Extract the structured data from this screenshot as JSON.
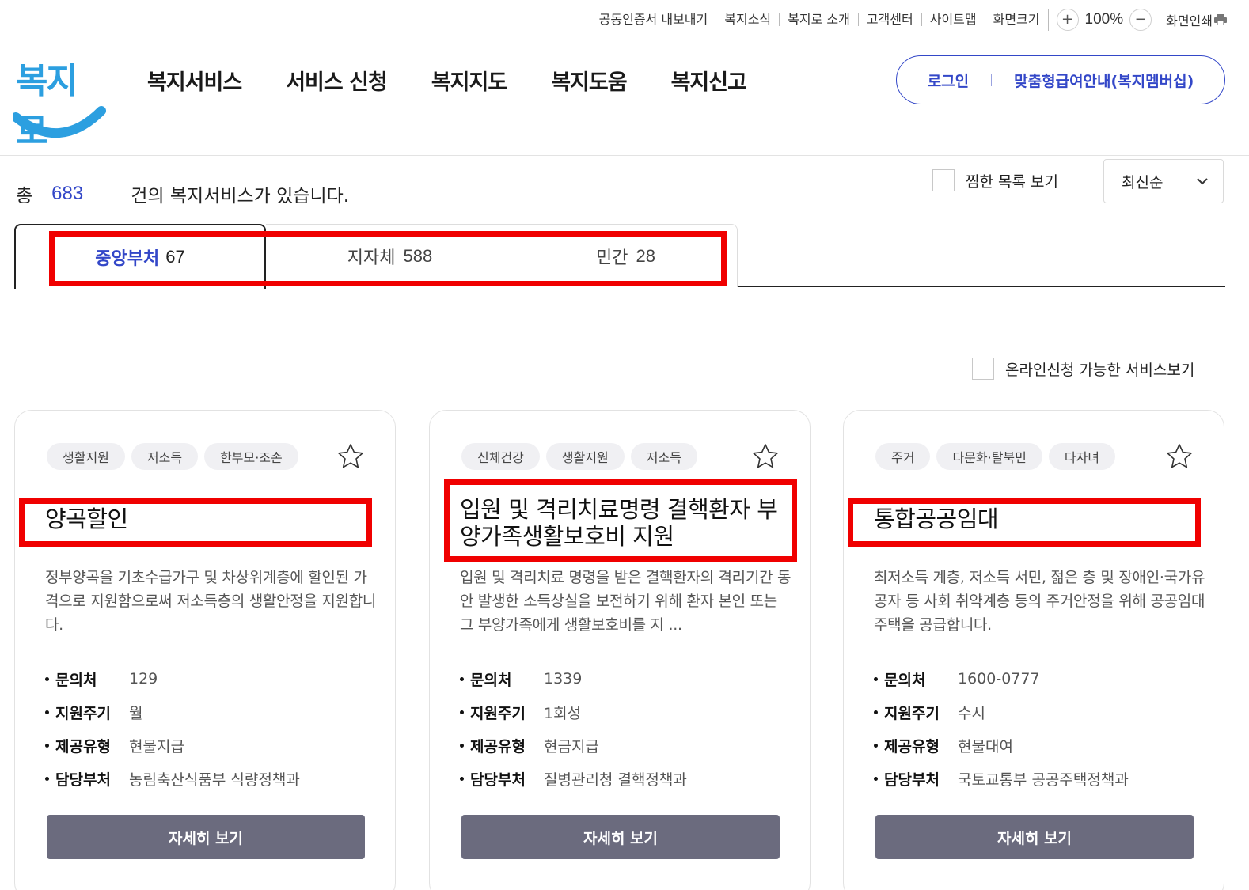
{
  "util": {
    "links": [
      "공동인증서 내보내기",
      "복지소식",
      "복지로 소개",
      "고객센터",
      "사이트맵",
      "화면크기"
    ],
    "zoom_in": "+",
    "zoom_value": "100%",
    "zoom_out": "−",
    "print": "화면인쇄"
  },
  "header": {
    "logo": "복지로",
    "nav": [
      "복지서비스",
      "서비스 신청",
      "복지지도",
      "복지도움",
      "복지신고"
    ],
    "login": "로그인",
    "membership": "맞춤형급여안내(복지멤버십)"
  },
  "summary": {
    "prefix": "총",
    "count": "683",
    "suffix": "건의 복지서비스가 있습니다.",
    "fav_label": "찜한 목록 보기",
    "sort_value": "최신순",
    "online_label": "온라인신청 가능한 서비스보기"
  },
  "tabs": [
    {
      "label": "중앙부처",
      "count": "67"
    },
    {
      "label": "지자체",
      "count": "588"
    },
    {
      "label": "민간",
      "count": "28"
    }
  ],
  "info_keys": [
    "문의처",
    "지원주기",
    "제공유형",
    "담당부처"
  ],
  "detail_label": "자세히 보기",
  "cards": [
    {
      "tags": [
        "생활지원",
        "저소득",
        "한부모·조손"
      ],
      "title": "양곡할인",
      "desc": "정부양곡을 기초수급가구 및 차상위계층에 할인된 가격으로 지원함으로써 저소득층의 생활안정을 지원합니다.",
      "contact": "129",
      "cycle": "월",
      "type": "현물지급",
      "dept": "농림축산식품부 식량정책과"
    },
    {
      "tags": [
        "신체건강",
        "생활지원",
        "저소득"
      ],
      "title": "입원 및 격리치료명령 결핵환자 부양가족생활보호비 지원",
      "desc": "입원 및 격리치료 명령을 받은 결핵환자의 격리기간 동안 발생한 소득상실을 보전하기 위해 환자 본인 또는 그 부양가족에게 생활보호비를 지 ...",
      "contact": "1339",
      "cycle": "1회성",
      "type": "현금지급",
      "dept": "질병관리청 결핵정책과"
    },
    {
      "tags": [
        "주거",
        "다문화·탈북민",
        "다자녀"
      ],
      "title": "통합공공임대",
      "desc": "최저소득 계층, 저소득 서민, 젊은 층 및 장애인·국가유공자 등 사회 취약계층 등의 주거안정을 위해 공공임대주택을 공급합니다.",
      "contact": "1600-0777",
      "cycle": "수시",
      "type": "현물대여",
      "dept": "국토교통부 공공주택정책과"
    }
  ],
  "colors": {
    "accent": "#3347c8",
    "highlight": "#f00000",
    "button": "#6b6b7e",
    "logo": "#2c9fe0"
  }
}
